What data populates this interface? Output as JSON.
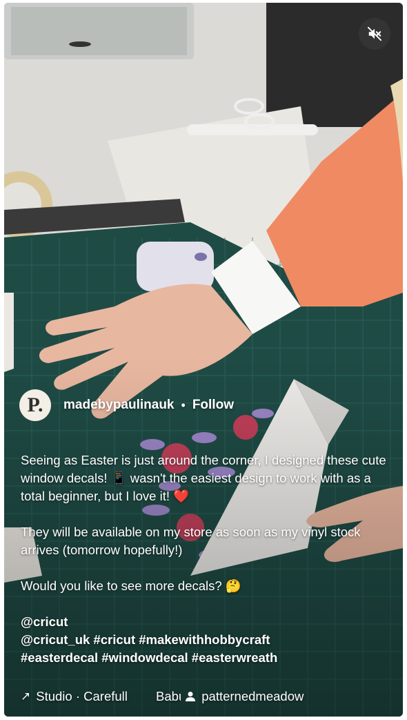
{
  "post": {
    "avatar_letter": "P.",
    "username": "madebypaulinauk",
    "separator": "•",
    "follow_label": "Follow",
    "caption_lines": [
      "Seeing as Easter is just around the corner, I designed these cute window decals! 📱 wasn't the easiest design to work with as a total beginner, but I love it! ❤️",
      "They will be available on my store as soon as my vinyl stock arrives (tomorrow hopefully!)",
      "Would you like to see more decals? 🤔"
    ],
    "mention": "@cricut",
    "tags_line1": "@cricut_uk #cricut #makewithhobbycraft",
    "tags_line2": "#easterdecal #windowdecal #easterwreath"
  },
  "audio": {
    "arrow": "↗",
    "track": "Studio · Carefull        Babu :",
    "credit": "patternedmeadow"
  },
  "controls": {
    "mute_icon": "speaker-muted-icon"
  },
  "colors": {
    "mat": "#1f4b45",
    "sleeve": "#f08a63",
    "text": "#ffffff"
  }
}
